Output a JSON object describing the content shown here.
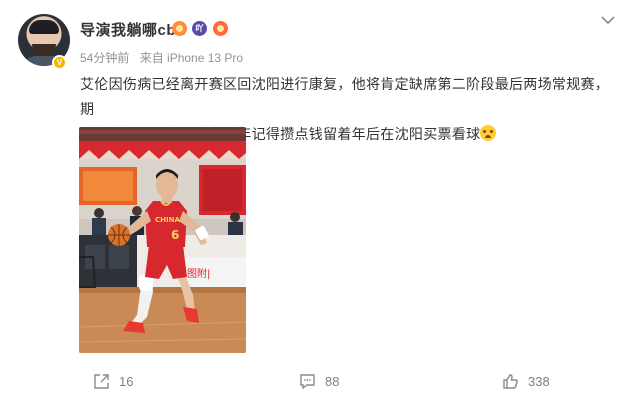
{
  "post": {
    "author": "导演我躺哪cba",
    "time": "54分钟前",
    "source": "来自 iPhone 13 Pro",
    "verified_glyph": "V",
    "badge_glyph": "吖",
    "text_line1": "艾伦因伤病已经离开赛区回沈阳进行康复，他将肯定缺席第二阶段最后两场常规赛，期",
    "text_line2": "待疫情赶紧好转，大家过年记得攒点钱留着年后在沈阳买票看球",
    "photo_banner_text": "图附| ",
    "jersey_text": "CHINA",
    "jersey_number": "6"
  },
  "actions": {
    "repost_count": "16",
    "comment_count": "88",
    "like_count": "338"
  },
  "colors": {
    "jersey_red": "#d7282f",
    "text_main": "#333333",
    "text_meta": "#939393",
    "action_gray": "#808080"
  },
  "icons": [
    "avatar",
    "verified-badge",
    "fan-badge-icon",
    "member-badge-icon",
    "hot-badge-icon",
    "chevron-down-icon",
    "crying-face-emoji",
    "repost-icon",
    "comment-icon",
    "like-icon"
  ]
}
